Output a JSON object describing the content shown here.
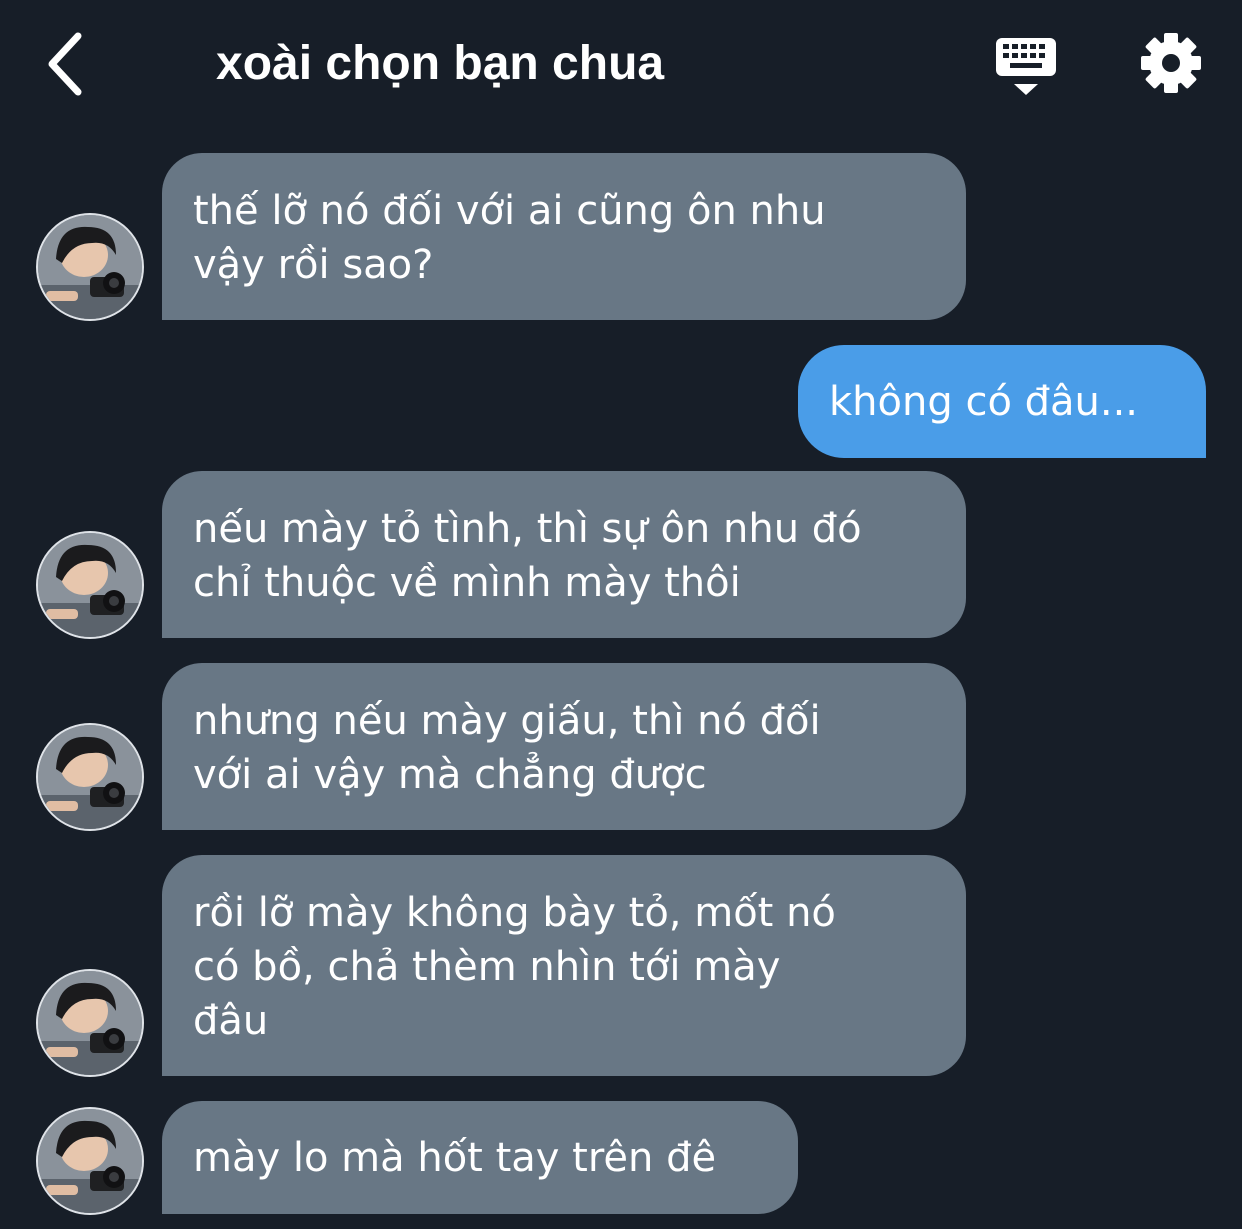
{
  "header": {
    "title": "xoài chọn bạn chua",
    "back_icon": "chevron-left-icon",
    "keyboard_icon": "keyboard-icon",
    "settings_icon": "gear-icon"
  },
  "colors": {
    "background": "#171e28",
    "incoming_bubble": "#687785",
    "outgoing_bubble": "#4a9de8",
    "text": "#ffffff"
  },
  "messages": [
    {
      "sender": "other",
      "lines": [
        "thế lỡ nó đối với ai cũng ôn nhu",
        "vậy rồi sao?"
      ]
    },
    {
      "sender": "me",
      "lines": [
        "không có đâu..."
      ]
    },
    {
      "sender": "other",
      "lines": [
        "nếu mày tỏ tình, thì sự ôn nhu đó",
        "chỉ thuộc về mình mày thôi"
      ]
    },
    {
      "sender": "other",
      "lines": [
        "nhưng nếu mày giấu, thì nó đối",
        "với ai vậy mà chẳng được"
      ]
    },
    {
      "sender": "other",
      "lines": [
        "rồi lỡ mày không bày tỏ, mốt nó",
        "có bồ, chả thèm nhìn tới mày",
        "đâu"
      ]
    },
    {
      "sender": "other",
      "lines": [
        "mày lo mà hốt tay trên đê"
      ]
    }
  ]
}
